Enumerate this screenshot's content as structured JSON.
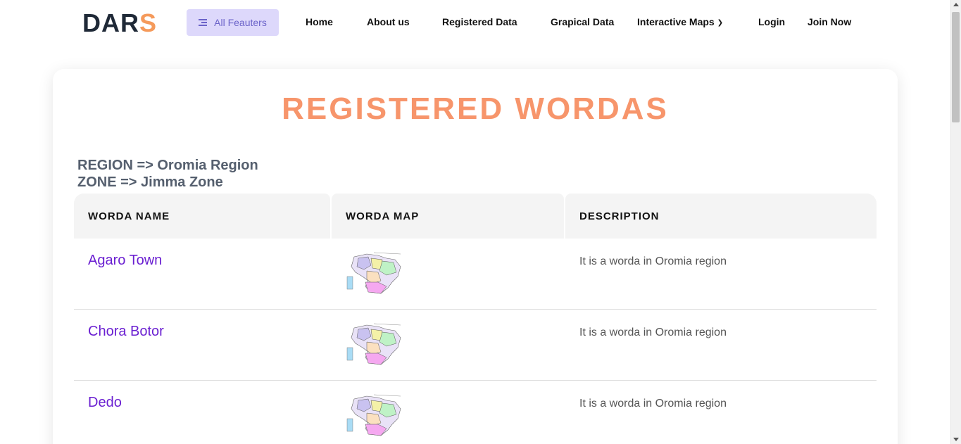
{
  "nav": {
    "logo_main": "DAR",
    "logo_accent": "S",
    "features_label": "All Feauters",
    "links": [
      "Home",
      "About us",
      "Registered Data",
      "Grapical Data",
      "Interactive Maps",
      "Login",
      "Join Now"
    ]
  },
  "page": {
    "title": "REGISTERED WORDAS",
    "region_line": "REGION => Oromia Region",
    "zone_line": "ZONE => Jimma Zone"
  },
  "table": {
    "headers": [
      "WORDA NAME",
      "WORDA MAP",
      "DESCRIPTION"
    ],
    "rows": [
      {
        "name": "Agaro Town",
        "description": "It is a worda in Oromia region",
        "map_icon": "worda-map-thumbnail"
      },
      {
        "name": "Chora Botor",
        "description": "It is a worda in Oromia region",
        "map_icon": "worda-map-thumbnail"
      },
      {
        "name": "Dedo",
        "description": "It is a worda in Oromia region",
        "map_icon": "worda-map-thumbnail"
      }
    ]
  },
  "colors": {
    "accent_orange": "#f59a5b",
    "title_orange": "#f7956b",
    "link_purple": "#6a1fd1",
    "features_bg": "#ddd8fb"
  }
}
